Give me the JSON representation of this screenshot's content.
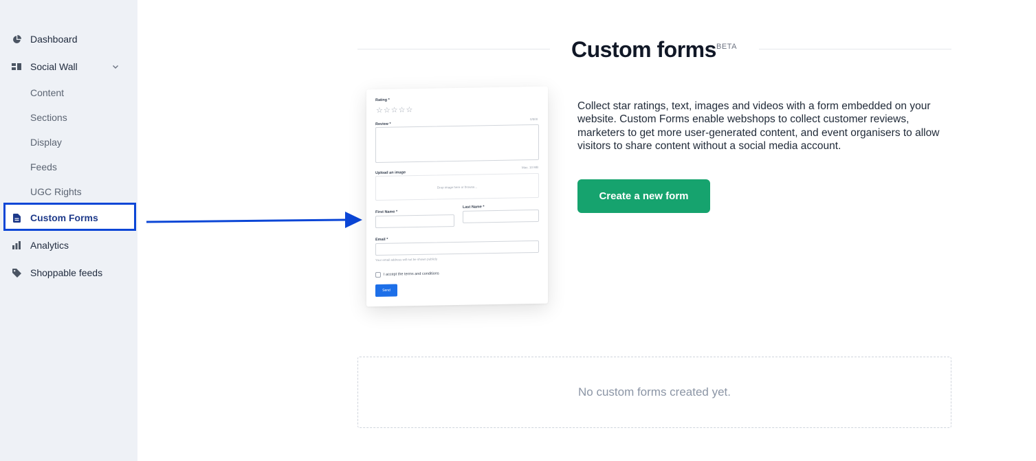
{
  "sidebar": {
    "items": [
      {
        "label": "Dashboard",
        "icon": "pie-chart-icon"
      },
      {
        "label": "Social Wall",
        "icon": "layout-icon",
        "expanded": true
      },
      {
        "label": "Custom Forms",
        "icon": "document-icon",
        "active": true
      },
      {
        "label": "Analytics",
        "icon": "bar-chart-icon"
      },
      {
        "label": "Shoppable feeds",
        "icon": "tag-icon"
      }
    ],
    "social_wall_sub": [
      "Content",
      "Sections",
      "Display",
      "Feeds",
      "UGC Rights"
    ]
  },
  "header": {
    "title": "Custom forms",
    "badge": "BETA"
  },
  "preview_form": {
    "rating_label": "Rating *",
    "review_label": "Review *",
    "review_counter": "0/500",
    "upload_label": "Upload an image",
    "upload_limit": "Max. 10 MB",
    "upload_hint": "Drop image here or browse...",
    "first_name_label": "First Name *",
    "last_name_label": "Last Name *",
    "email_label": "Email *",
    "email_note": "Your email address will not be shown publicly",
    "terms_label": "I accept the terms and conditions",
    "send_label": "Send"
  },
  "main": {
    "description": "Collect star ratings, text, images and videos with a form embedded on your website. Custom Forms enable webshops to collect customer reviews, marketers to get more user-generated content, and event organisers to allow visitors to share content without a social media account.",
    "create_button": "Create a new form",
    "empty_state": "No custom forms created yet."
  },
  "colors": {
    "accent_green": "#16a36e",
    "annotation_blue": "#0b46d6",
    "sidebar_bg": "#eef1f6"
  }
}
